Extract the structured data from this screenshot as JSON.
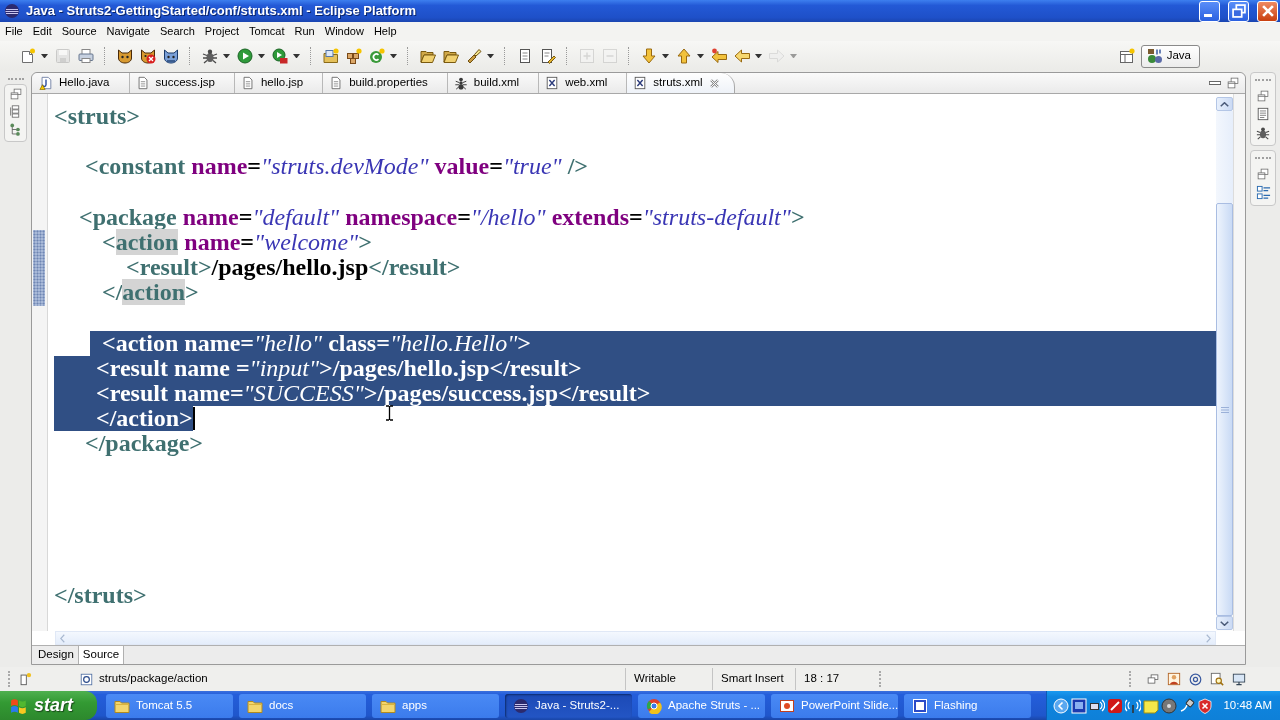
{
  "window": {
    "title": "Java - Struts2-GettingStarted/conf/struts.xml - Eclipse Platform"
  },
  "menu": [
    "File",
    "Edit",
    "Source",
    "Navigate",
    "Search",
    "Project",
    "Tomcat",
    "Run",
    "Window",
    "Help"
  ],
  "perspective": {
    "label": "Java"
  },
  "editor": {
    "tabs": [
      {
        "label": "Hello.java",
        "kind": "java",
        "selected": false
      },
      {
        "label": "success.jsp",
        "kind": "file",
        "selected": false
      },
      {
        "label": "hello.jsp",
        "kind": "file",
        "selected": false
      },
      {
        "label": "build.properties",
        "kind": "file",
        "selected": false
      },
      {
        "label": "build.xml",
        "kind": "ant",
        "selected": false
      },
      {
        "label": "web.xml",
        "kind": "xml",
        "selected": false
      },
      {
        "label": "struts.xml",
        "kind": "xml",
        "selected": true
      }
    ],
    "lines": [
      {
        "kind": "code",
        "selected": false,
        "in_range": false,
        "tokens": [
          {
            "kind": "tag",
            "text": "<struts>"
          }
        ]
      },
      {
        "kind": "blank",
        "selected": false,
        "in_range": false
      },
      {
        "kind": "code",
        "selected": false,
        "in_range": false,
        "tokens": [
          {
            "kind": "tag",
            "text": "<constant "
          },
          {
            "kind": "attr",
            "text": "name"
          },
          {
            "kind": "text",
            "text": "="
          },
          {
            "kind": "value",
            "text": "\"struts.devMode\" "
          },
          {
            "kind": "attr",
            "text": "value"
          },
          {
            "kind": "text",
            "text": "="
          },
          {
            "kind": "value",
            "text": "\"true\" "
          },
          {
            "kind": "tag",
            "text": "/>"
          }
        ]
      },
      {
        "kind": "blank",
        "selected": false,
        "in_range": false
      },
      {
        "kind": "code",
        "selected": false,
        "in_range": false,
        "tokens": [
          {
            "kind": "tag",
            "text": "<package "
          },
          {
            "kind": "attr",
            "text": "name"
          },
          {
            "kind": "text",
            "text": "="
          },
          {
            "kind": "value",
            "text": "\"default\" "
          },
          {
            "kind": "attr",
            "text": "namespace"
          },
          {
            "kind": "text",
            "text": "="
          },
          {
            "kind": "value",
            "text": "\"/hello\" "
          },
          {
            "kind": "attr",
            "text": "extends"
          },
          {
            "kind": "text",
            "text": "="
          },
          {
            "kind": "value",
            "text": "\"struts-default\""
          },
          {
            "kind": "tag",
            "text": ">"
          }
        ]
      },
      {
        "kind": "code",
        "selected": false,
        "in_range": true,
        "tokens": [
          {
            "kind": "tag",
            "text": "<"
          },
          {
            "kind": "occurrence",
            "text": "action"
          },
          {
            "kind": "attr",
            "text": " name"
          },
          {
            "kind": "text",
            "text": "="
          },
          {
            "kind": "value",
            "text": "\"welcome\""
          },
          {
            "kind": "tag",
            "text": ">"
          }
        ]
      },
      {
        "kind": "code",
        "selected": false,
        "in_range": true,
        "tokens": [
          {
            "kind": "tag",
            "text": "<result>"
          },
          {
            "kind": "text",
            "text": "/pages/hello.jsp"
          },
          {
            "kind": "tag",
            "text": "</result>"
          }
        ]
      },
      {
        "kind": "code",
        "selected": false,
        "in_range": true,
        "tokens": [
          {
            "kind": "tag",
            "text": "</"
          },
          {
            "kind": "occurrence",
            "text": "action"
          },
          {
            "kind": "tag",
            "text": ">"
          }
        ]
      },
      {
        "kind": "blank",
        "selected": false,
        "in_range": false
      },
      {
        "kind": "code",
        "selected": true,
        "in_range": false,
        "tokens": [
          {
            "kind": "tag",
            "text": "<action "
          },
          {
            "kind": "attr",
            "text": "name"
          },
          {
            "kind": "text",
            "text": "="
          },
          {
            "kind": "value",
            "text": "\"hello\" "
          },
          {
            "kind": "attr",
            "text": "class"
          },
          {
            "kind": "text",
            "text": "="
          },
          {
            "kind": "value",
            "text": "\"hello.Hello\""
          },
          {
            "kind": "tag",
            "text": ">"
          }
        ]
      },
      {
        "kind": "code",
        "selected": true,
        "in_range": false,
        "tokens": [
          {
            "kind": "tag",
            "text": "<result "
          },
          {
            "kind": "attr",
            "text": "name "
          },
          {
            "kind": "text",
            "text": "="
          },
          {
            "kind": "value",
            "text": "\"input\""
          },
          {
            "kind": "tag",
            "text": ">"
          },
          {
            "kind": "text",
            "text": "/pages/hello.jsp"
          },
          {
            "kind": "tag",
            "text": "</result>"
          }
        ]
      },
      {
        "kind": "code",
        "selected": true,
        "in_range": false,
        "tokens": [
          {
            "kind": "tag",
            "text": "<result "
          },
          {
            "kind": "attr",
            "text": "name"
          },
          {
            "kind": "text",
            "text": "="
          },
          {
            "kind": "value",
            "text": "\"SUCCESS\""
          },
          {
            "kind": "tag",
            "text": ">"
          },
          {
            "kind": "text",
            "text": "/pages/success.jsp"
          },
          {
            "kind": "tag",
            "text": "</result>"
          }
        ]
      },
      {
        "kind": "code",
        "selected": true,
        "in_range": false,
        "tokens": [
          {
            "kind": "tag",
            "text": "</action>"
          }
        ]
      },
      {
        "kind": "code",
        "selected": false,
        "in_range": false,
        "tokens": [
          {
            "kind": "tag",
            "text": "</package>"
          }
        ]
      },
      {
        "kind": "blank",
        "selected": false,
        "in_range": false
      },
      {
        "kind": "blank",
        "selected": false,
        "in_range": false
      },
      {
        "kind": "blank",
        "selected": false,
        "in_range": false
      },
      {
        "kind": "blank",
        "selected": false,
        "in_range": false
      },
      {
        "kind": "blank",
        "selected": false,
        "in_range": false
      },
      {
        "kind": "code",
        "selected": false,
        "in_range": false,
        "tokens": [
          {
            "kind": "tag",
            "text": "</struts>"
          }
        ]
      }
    ],
    "bottom_tabs": [
      {
        "label": "Design",
        "selected": false
      },
      {
        "label": "Source",
        "selected": true
      }
    ]
  },
  "status_bar": {
    "path": "struts/package/action",
    "mode": "Writable",
    "insert_mode": "Smart Insert",
    "position": "18 : 17"
  },
  "taskbar": {
    "start": "start",
    "items": [
      {
        "label": "Tomcat 5.5",
        "kind": "folder",
        "selected": false
      },
      {
        "label": "docs",
        "kind": "folder",
        "selected": false
      },
      {
        "label": "apps",
        "kind": "folder",
        "selected": false
      },
      {
        "label": "Java - Struts2-...",
        "kind": "ide",
        "selected": true
      },
      {
        "label": "Apache Struts - ...",
        "kind": "browser",
        "selected": false
      },
      {
        "label": "PowerPoint Slide...",
        "kind": "slides",
        "selected": false
      },
      {
        "label": "Flashing",
        "kind": "window",
        "selected": false
      }
    ],
    "clock": "10:48 AM"
  }
}
